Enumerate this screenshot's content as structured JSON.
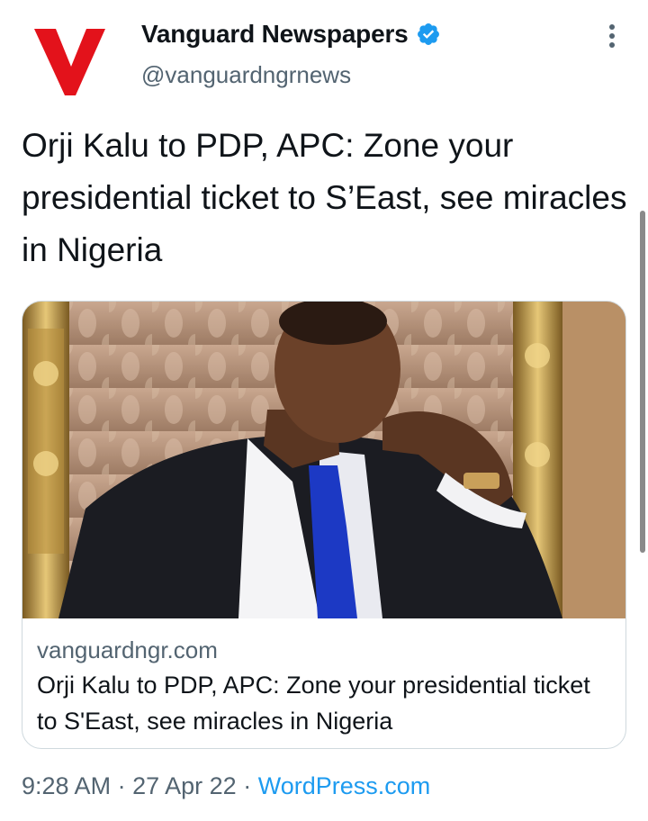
{
  "account": {
    "display_name": "Vanguard Newspapers",
    "handle": "@vanguardngrnews",
    "logo_letter": "V",
    "logo_color": "#e3121b",
    "verified": true
  },
  "tweet": {
    "text": "Orji Kalu to PDP, APC: Zone your presidential ticket to S’East, see miracles in Nigeria"
  },
  "card": {
    "domain": "vanguardngr.com",
    "title": "Orji Kalu to PDP, APC: Zone your presidential ticket to S'East, see miracles in Nigeria"
  },
  "meta": {
    "time": "9:28 AM",
    "separator": "·",
    "date": "27 Apr 22",
    "source": "WordPress.com"
  },
  "colors": {
    "text": "#0f1419",
    "secondary": "#536471",
    "link": "#1d9bf0",
    "verified_badge": "#1d9bf0"
  },
  "icons": [
    "vanguard-logo",
    "verified-badge-icon",
    "more-options-icon"
  ]
}
